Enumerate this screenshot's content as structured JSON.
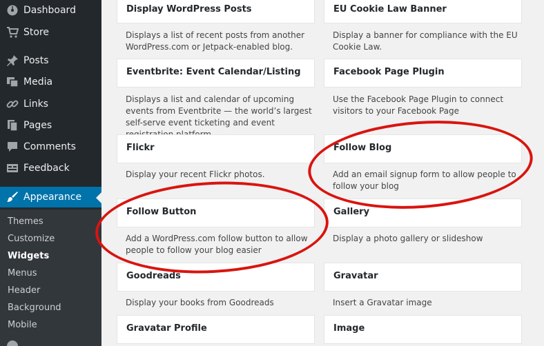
{
  "sidebar": {
    "items": [
      {
        "label": "Dashboard",
        "icon": "dashboard-icon"
      },
      {
        "label": "Store",
        "icon": "cart-icon"
      },
      {
        "label": "Posts",
        "icon": "pin-icon"
      },
      {
        "label": "Media",
        "icon": "media-icon"
      },
      {
        "label": "Links",
        "icon": "link-icon"
      },
      {
        "label": "Pages",
        "icon": "pages-icon"
      },
      {
        "label": "Comments",
        "icon": "comment-icon"
      },
      {
        "label": "Feedback",
        "icon": "feedback-icon"
      },
      {
        "label": "Appearance",
        "icon": "paintbrush-icon"
      }
    ],
    "submenu": [
      "Themes",
      "Customize",
      "Widgets",
      "Menus",
      "Header",
      "Background",
      "Mobile"
    ],
    "current_submenu": "Widgets"
  },
  "widgets": {
    "left": [
      {
        "title": "Display WordPress Posts",
        "desc": "Displays a list of recent posts from another WordPress.com or Jetpack-enabled blog."
      },
      {
        "title": "Eventbrite: Event Calendar/Listing",
        "desc": "Displays a list and calendar of upcoming events from Eventbrite — the world’s largest self-serve event ticketing and event registration platform."
      },
      {
        "title": "Flickr",
        "desc": "Display your recent Flickr photos."
      },
      {
        "title": "Follow Button",
        "desc": "Add a WordPress.com follow button to allow people to follow your blog easier"
      },
      {
        "title": "Goodreads",
        "desc": "Display your books from Goodreads"
      },
      {
        "title": "Gravatar Profile",
        "desc": ""
      }
    ],
    "right": [
      {
        "title": "EU Cookie Law Banner",
        "desc": "Display a banner for compliance with the EU Cookie Law."
      },
      {
        "title": "Facebook Page Plugin",
        "desc": "Use the Facebook Page Plugin to connect visitors to your Facebook Page"
      },
      {
        "title": "Follow Blog",
        "desc": "Add an email signup form to allow people to follow your blog"
      },
      {
        "title": "Gallery",
        "desc": "Display a photo gallery or slideshow"
      },
      {
        "title": "Gravatar",
        "desc": "Insert a Gravatar image"
      },
      {
        "title": "Image",
        "desc": ""
      }
    ]
  },
  "colors": {
    "sidebar_bg": "#23282d",
    "active_bg": "#0073aa",
    "annotation": "#d9140f"
  }
}
